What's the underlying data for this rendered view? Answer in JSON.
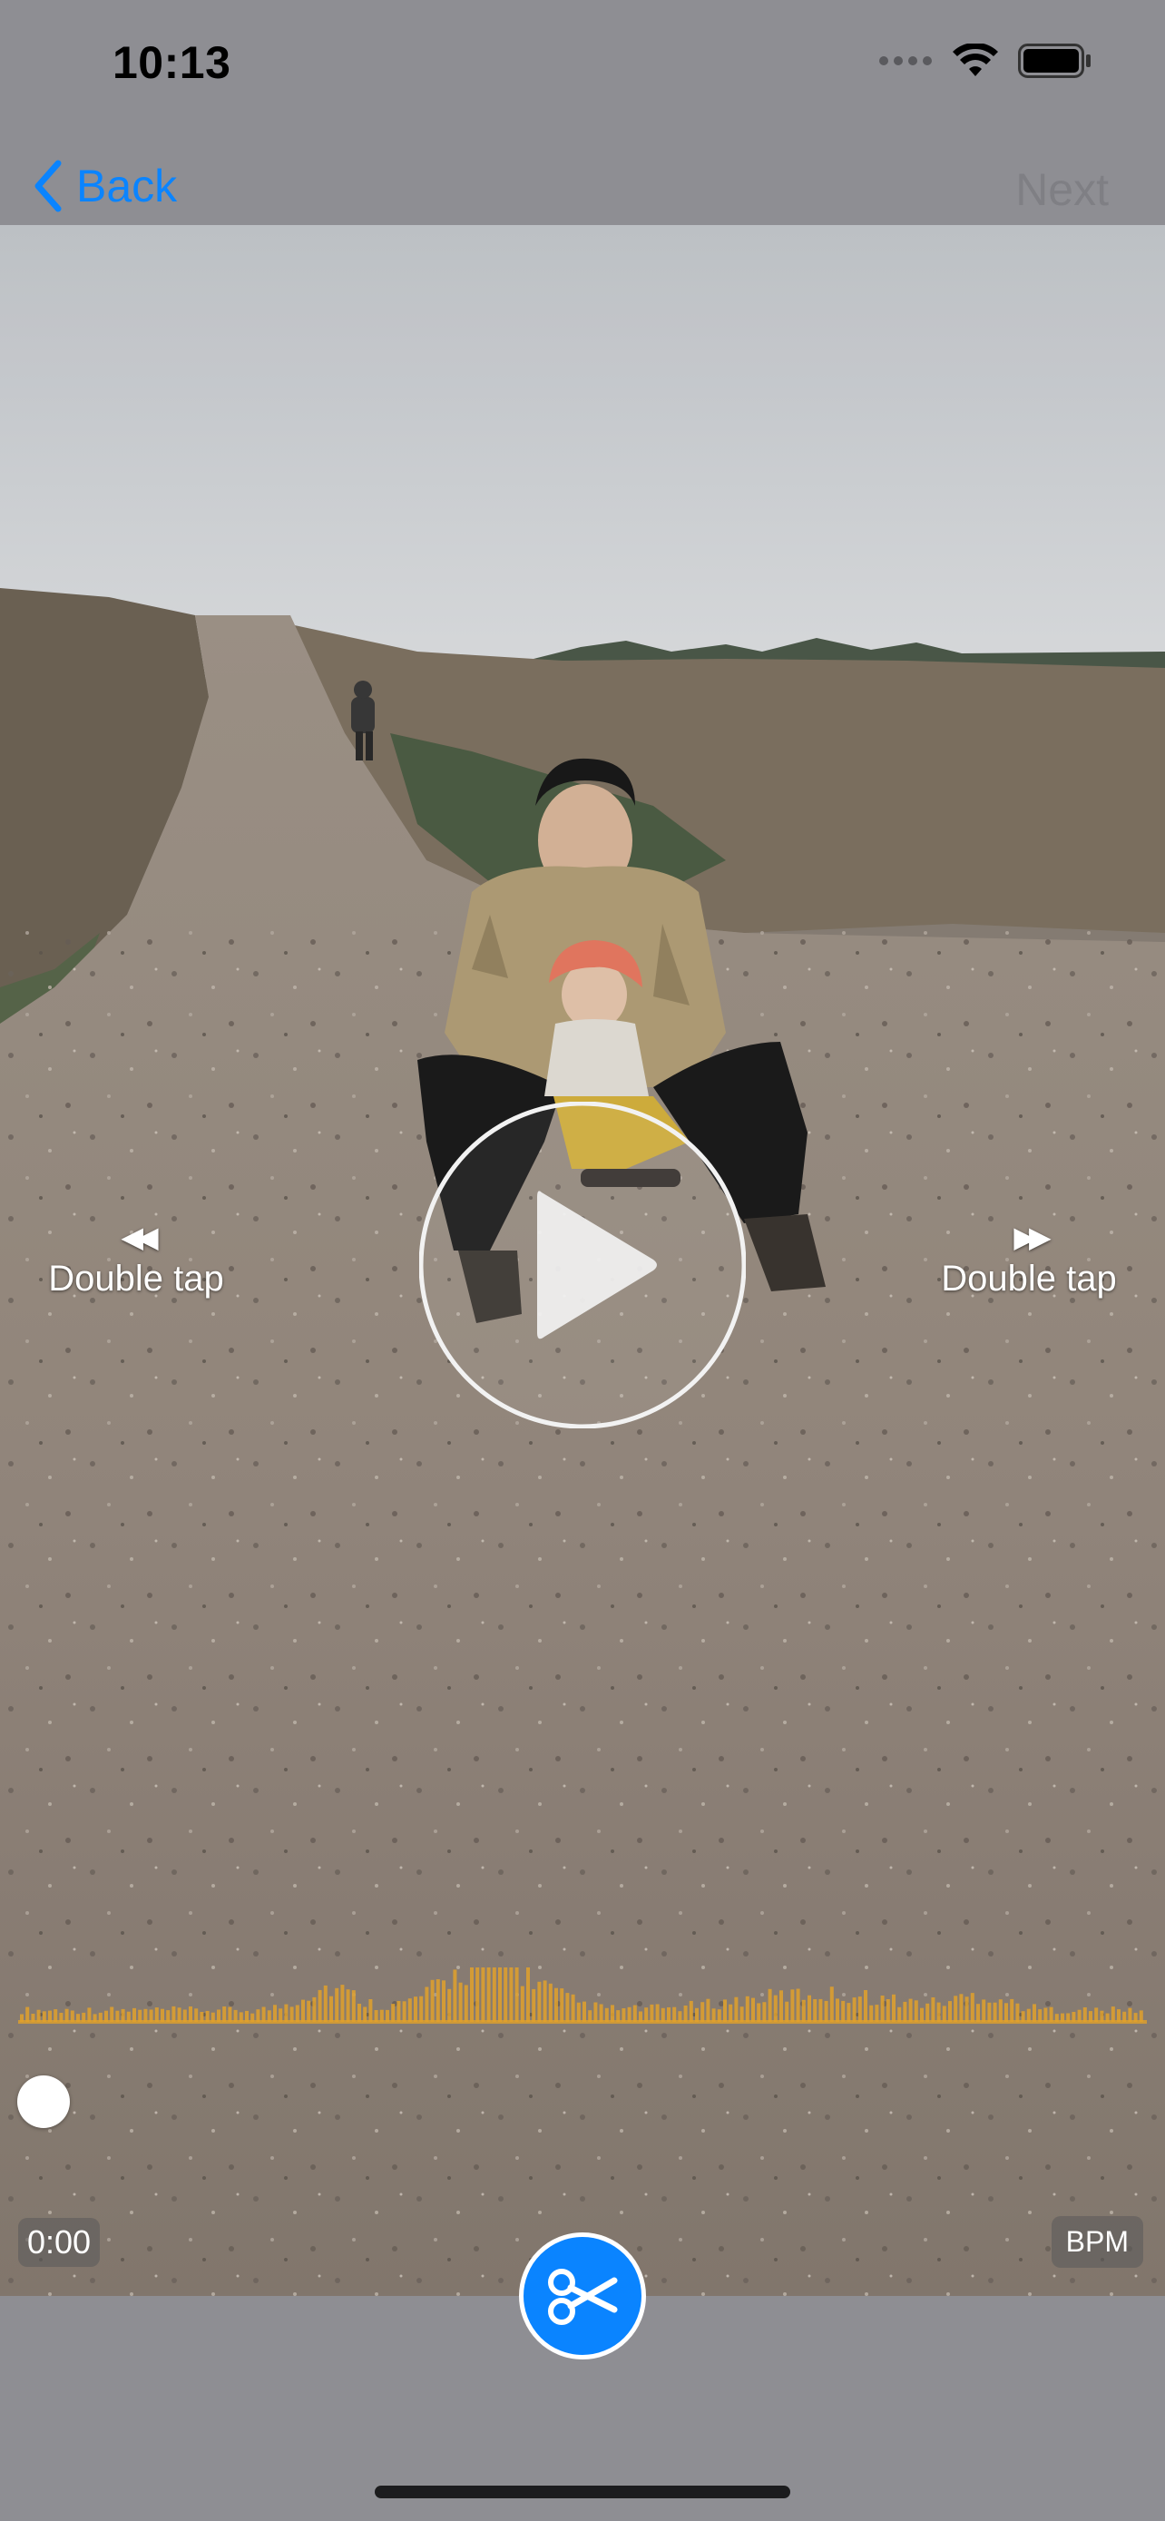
{
  "status_bar": {
    "time": "10:13"
  },
  "nav": {
    "back_label": "Back",
    "next_label": "Next"
  },
  "player": {
    "seek_back_arrows": "◀◀",
    "seek_back_hint": "Double tap",
    "seek_forward_arrows": "▶▶",
    "seek_forward_hint": "Double tap",
    "current_time": "0:00",
    "bpm_label": "BPM"
  },
  "colors": {
    "accent": "#0a84ff",
    "waveform": "#e0a12b",
    "bar_background": "#8e8e93",
    "next_disabled": "#7f7f84"
  },
  "icons": {
    "back": "chevron-left-icon",
    "play": "play-icon",
    "cut": "scissors-icon",
    "wifi": "wifi-icon",
    "battery": "battery-icon",
    "signal": "signal-icon"
  }
}
